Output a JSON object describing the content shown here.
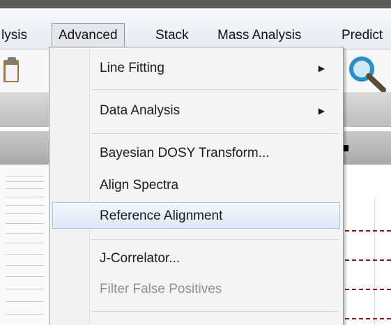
{
  "menubar": {
    "items": [
      "lysis",
      "Advanced",
      "Stack",
      "Mass Analysis",
      "Predict"
    ],
    "active_index": 1
  },
  "dropdown": {
    "items": [
      {
        "label": "Line Fitting",
        "submenu": true
      },
      {
        "label": "Data Analysis",
        "submenu": true
      },
      {
        "label": "Bayesian DOSY Transform..."
      },
      {
        "label": "Align Spectra"
      },
      {
        "label": "Reference Alignment",
        "highlighted": true
      },
      {
        "label": "J-Correlator..."
      },
      {
        "label": "Filter False Positives",
        "disabled": true
      }
    ],
    "submenu_arrow": "▶"
  },
  "colors": {
    "menubar_bg": "#e9eef3",
    "highlight_border": "#a9c4e3",
    "disabled_text": "#8f8f8f",
    "plot_line": "#8a1a1a"
  },
  "icons": [
    "clipboard-icon",
    "search-icon",
    "chevron-right-icon"
  ]
}
